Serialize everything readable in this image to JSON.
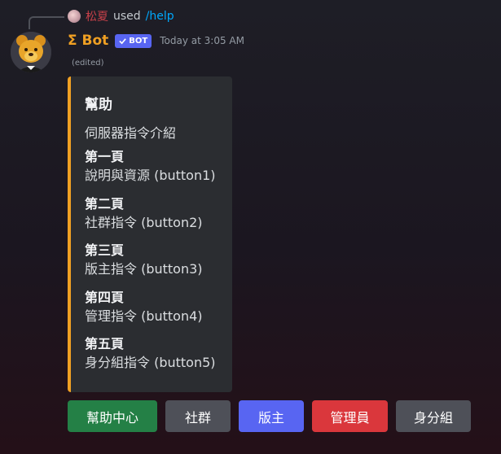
{
  "reply": {
    "username": "松夏",
    "used_text": "used",
    "command": "/help"
  },
  "message": {
    "author": "Σ Bot",
    "bot_tag": "BOT",
    "timestamp": "Today at 3:05 AM",
    "edited": "(edited)"
  },
  "embed": {
    "accent_color": "#f0a023",
    "title": "幫助",
    "description": "伺服器指令介紹",
    "fields": [
      {
        "name": "第一頁",
        "value": "說明與資源 (button1)"
      },
      {
        "name": "第二頁",
        "value": "社群指令 (button2)"
      },
      {
        "name": "第三頁",
        "value": "版主指令 (button3)"
      },
      {
        "name": "第四頁",
        "value": "管理指令 (button4)"
      },
      {
        "name": "第五頁",
        "value": "身分組指令 (button5)"
      }
    ]
  },
  "buttons": [
    {
      "label": "幫助中心",
      "color": "#248046"
    },
    {
      "label": "社群",
      "color": "#4e5058"
    },
    {
      "label": "版主",
      "color": "#5865f2"
    },
    {
      "label": "管理員",
      "color": "#da373c"
    },
    {
      "label": "身分組",
      "color": "#4e5058"
    }
  ],
  "icons": {
    "verified": "checkmark-icon",
    "avatar": "bear-avatar"
  }
}
